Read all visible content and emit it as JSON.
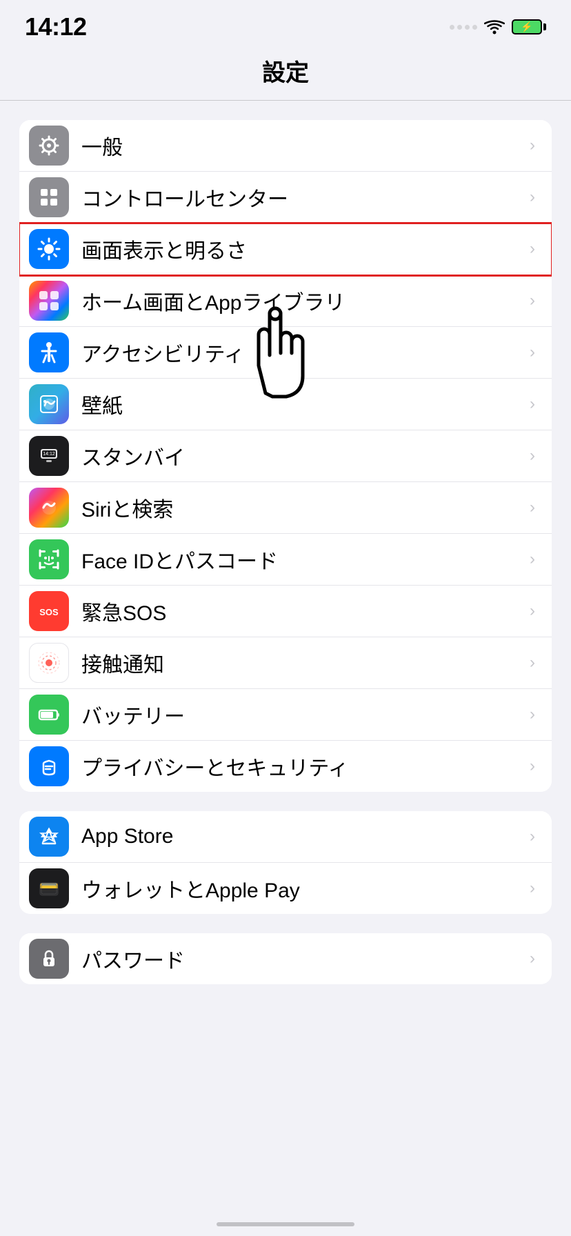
{
  "statusBar": {
    "time": "14:12",
    "battery": "⚡"
  },
  "pageTitle": "設定",
  "group1": {
    "items": [
      {
        "id": "general",
        "label": "一般",
        "iconBg": "icon-gray",
        "iconSymbol": "⚙️"
      },
      {
        "id": "control-center",
        "label": "コントロールセンター",
        "iconBg": "icon-gray",
        "iconSymbol": "⊟"
      },
      {
        "id": "display",
        "label": "画面表示と明るさ",
        "iconBg": "icon-blue",
        "iconSymbol": "☀",
        "highlighted": true
      },
      {
        "id": "home-screen",
        "label": "ホーム画面とAppライブラリ",
        "iconBg": "icon-multicolor",
        "iconSymbol": "⊞"
      },
      {
        "id": "accessibility",
        "label": "アクセシビリティ",
        "iconBg": "icon-blue",
        "iconSymbol": "♿"
      },
      {
        "id": "wallpaper",
        "label": "壁紙",
        "iconBg": "icon-teal",
        "iconSymbol": "✿"
      },
      {
        "id": "standby",
        "label": "スタンバイ",
        "iconBg": "icon-black",
        "iconSymbol": "⊡"
      },
      {
        "id": "siri",
        "label": "Siriと検索",
        "iconBg": "icon-gradient-siri",
        "iconSymbol": ""
      },
      {
        "id": "faceid",
        "label": "Face IDとパスコード",
        "iconBg": "icon-green",
        "iconSymbol": "☺"
      },
      {
        "id": "sos",
        "label": "緊急SOS",
        "iconBg": "icon-red",
        "iconSymbol": "SOS"
      },
      {
        "id": "exposure",
        "label": "接触通知",
        "iconBg": "icon-white",
        "iconSymbol": "⦿"
      },
      {
        "id": "battery",
        "label": "バッテリー",
        "iconBg": "icon-green",
        "iconSymbol": "▬"
      },
      {
        "id": "privacy",
        "label": "プライバシーとセキュリティ",
        "iconBg": "icon-blue",
        "iconSymbol": "✋"
      }
    ]
  },
  "group2": {
    "items": [
      {
        "id": "appstore",
        "label": "App Store",
        "iconBg": "icon-blue-light",
        "iconSymbol": "A"
      },
      {
        "id": "wallet",
        "label": "ウォレットとApple Pay",
        "iconBg": "icon-wallet",
        "iconSymbol": "💳"
      }
    ]
  },
  "group3": {
    "items": [
      {
        "id": "passwords",
        "label": "パスワード",
        "iconBg": "icon-gray-dark",
        "iconSymbol": "🔑"
      }
    ]
  },
  "chevron": "›"
}
